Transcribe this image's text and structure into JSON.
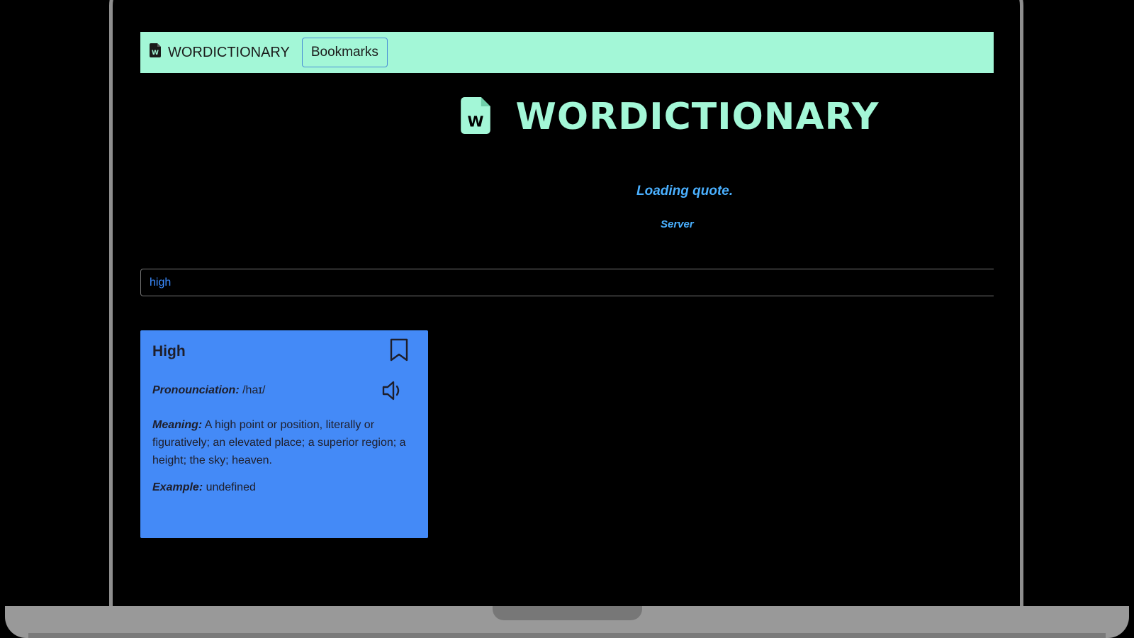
{
  "navbar": {
    "brand": "WORDICTIONARY",
    "brand_icon": "file-word-icon",
    "bookmarks_label": "Bookmarks"
  },
  "hero": {
    "title": "WORDICTIONARY",
    "icon": "file-word-icon"
  },
  "quote": {
    "text": "Loading quote.",
    "author": "Server"
  },
  "search": {
    "value": "high"
  },
  "result": {
    "word": "High",
    "pronunciation_label": "Pronounciation:",
    "pronunciation": " /haɪ/",
    "meaning_label": "Meaning:",
    "meaning": " A high point or position, literally or figuratively; an elevated place; a superior region; a height; the sky; heaven.",
    "example_label": "Example:",
    "example": " undefined",
    "bookmark_icon": "bookmark-icon",
    "speaker_icon": "speaker-icon"
  },
  "colors": {
    "navbar_bg": "#a3f7d7",
    "title": "#a3f7d7",
    "quote": "#4ab0ff",
    "card_bg": "#448af7"
  }
}
